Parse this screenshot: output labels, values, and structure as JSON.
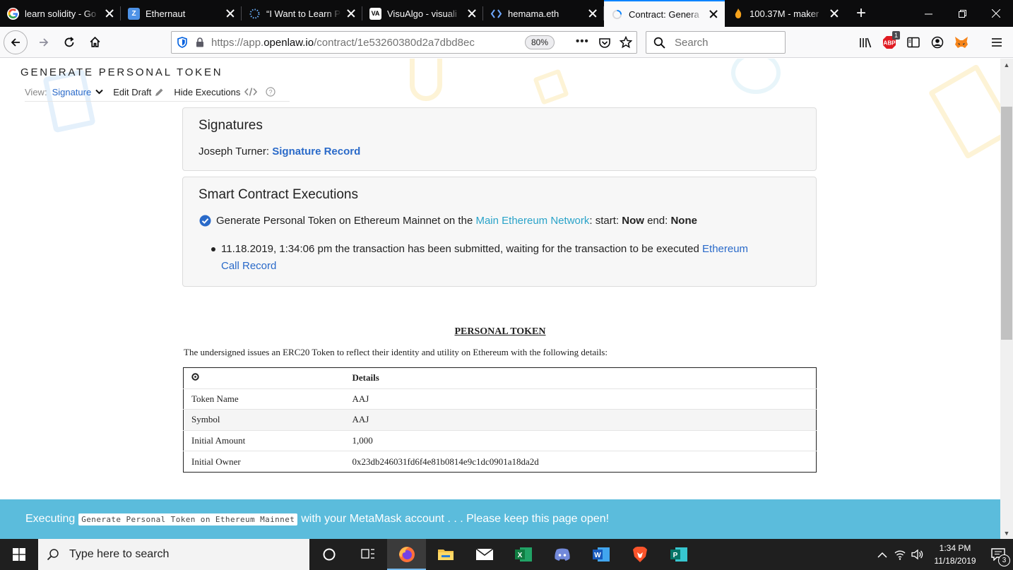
{
  "browser": {
    "tabs": [
      {
        "title": "learn solidity - Go",
        "favicon": "google-icon",
        "active": false
      },
      {
        "title": "Ethernaut",
        "favicon": "zeppelin-icon",
        "active": false
      },
      {
        "title": "“I Want to Learn P",
        "favicon": "dotted-circle-icon",
        "active": false
      },
      {
        "title": "VisuAlgo - visuali",
        "favicon": "visualgo-icon",
        "active": false
      },
      {
        "title": "hemama.eth",
        "favicon": "brackets-icon",
        "active": false
      },
      {
        "title": "Contract: Genera",
        "favicon": "loading-spinner-icon",
        "active": true
      },
      {
        "title": "100.37M - maker",
        "favicon": "maker-flame-icon",
        "active": false
      }
    ],
    "url_prefix": "https://app.",
    "url_domain": "openlaw.io",
    "url_path": "/contract/1e53260380d2a7dbd8ec",
    "zoom": "80%",
    "search_placeholder": "Search",
    "adblock_badge": "1"
  },
  "page": {
    "doc_title": "GENERATE PERSONAL TOKEN",
    "nav": {
      "view_label": "View:",
      "view_value": "Signature",
      "edit_draft": "Edit Draft",
      "hide_executions": "Hide Executions"
    },
    "signatures": {
      "heading": "Signatures",
      "signer": "Joseph Turner:",
      "record_link": "Signature Record"
    },
    "executions": {
      "heading": "Smart Contract Executions",
      "item_text": "Generate Personal Token on Ethereum Mainnet on the",
      "network_link": "Main Ethereum Network",
      "start_label": ": start:",
      "start_value": "Now",
      "end_label": "end:",
      "end_value": "None",
      "log_line": "11.18.2019, 1:34:06 pm the transaction has been submitted, waiting for the transaction to be executed",
      "log_link_1": "Ethereum",
      "log_link_2": "Call Record"
    },
    "contract": {
      "title": "PERSONAL TOKEN",
      "intro": "The undersigned issues an ERC20 Token to reflect their identity and utility on Ethereum with the following details:",
      "table_header": "Details",
      "rows": [
        {
          "label": "Token Name",
          "value": "AAJ"
        },
        {
          "label": "Symbol",
          "value": "AAJ"
        },
        {
          "label": "Initial Amount",
          "value": "1,000"
        },
        {
          "label": "Initial Owner",
          "value": "0x23db246031fd6f4e81b0814e9c1dc0901a18da2d"
        }
      ]
    },
    "banner": {
      "prefix": "Executing",
      "code": "Generate Personal Token on Ethereum Mainnet",
      "suffix": "with your MetaMask account . . . Please keep this page open!"
    }
  },
  "taskbar": {
    "search_placeholder": "Type here to search",
    "time": "1:34 PM",
    "date": "11/18/2019",
    "notification_count": "3"
  }
}
